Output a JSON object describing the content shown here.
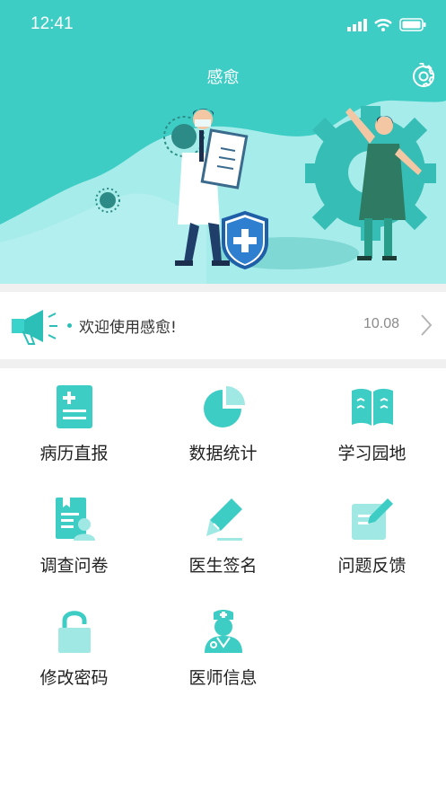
{
  "status_bar": {
    "time": "12:41"
  },
  "header": {
    "title": "感愈"
  },
  "notice": {
    "text": "欢迎使用感愈!",
    "number": "10.08"
  },
  "menu": [
    {
      "label": "病历直报",
      "icon": "medical-record-icon"
    },
    {
      "label": "数据统计",
      "icon": "pie-chart-icon"
    },
    {
      "label": "学习园地",
      "icon": "open-book-icon"
    },
    {
      "label": "调查问卷",
      "icon": "questionnaire-icon"
    },
    {
      "label": "医生签名",
      "icon": "pen-icon"
    },
    {
      "label": "问题反馈",
      "icon": "feedback-icon"
    },
    {
      "label": "修改密码",
      "icon": "lock-icon"
    },
    {
      "label": "医师信息",
      "icon": "doctor-icon"
    }
  ],
  "colors": {
    "accent": "#3ecdc5",
    "accent_light": "#9fe8e4",
    "gap": "#f0f0f0"
  }
}
